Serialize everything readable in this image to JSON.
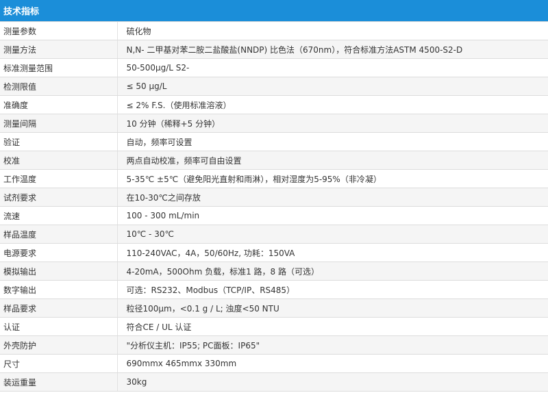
{
  "header": {
    "title": "技术指标"
  },
  "rows": [
    {
      "label": "测量参数",
      "value": "硫化物"
    },
    {
      "label": "测量方法",
      "value": "N,N- 二甲基对苯二胺二盐酸盐(NNDP) 比色法（670nm），符合标准方法ASTM 4500-S2-D"
    },
    {
      "label": "标准测量范围",
      "value": "50-500μg/L S2-"
    },
    {
      "label": "检测限值",
      "value": "≤ 50 μg/L"
    },
    {
      "label": "准确度",
      "value": "≤ 2% F.S.（使用标准溶液）"
    },
    {
      "label": "测量间隔",
      "value": "10 分钟（稀释+5 分钟）"
    },
    {
      "label": "验证",
      "value": "自动，频率可设置"
    },
    {
      "label": "校准",
      "value": "两点自动校准，频率可自由设置"
    },
    {
      "label": "工作温度",
      "value": "5-35℃ ±5℃（避免阳光直射和雨淋），相对湿度为5-95%（非冷凝）"
    },
    {
      "label": "试剂要求",
      "value": "在10-30℃之间存放"
    },
    {
      "label": "流速",
      "value": "100 - 300 mL/min"
    },
    {
      "label": "样品温度",
      "value": "10℃ - 30℃"
    },
    {
      "label": "电源要求",
      "value": "110-240VAC，4A，50/60Hz, 功耗：150VA"
    },
    {
      "label": "模拟输出",
      "value": "4-20mA，500Ohm 负载，标准1 路，8 路（可选）"
    },
    {
      "label": "数字输出",
      "value": "可选：RS232、Modbus（TCP/IP、RS485）"
    },
    {
      "label": "样品要求",
      "value": "粒径100μm，<0.1 g / L; 浊度<50 NTU"
    },
    {
      "label": "认证",
      "value": "符合CE / UL 认证"
    },
    {
      "label": "外壳防护",
      "value": "\"分析仪主机：IP55;      PC面板：IP65\""
    },
    {
      "label": "尺寸",
      "value": "690mmx 465mmx 330mm"
    },
    {
      "label": "装运重量",
      "value": "30kg"
    }
  ]
}
